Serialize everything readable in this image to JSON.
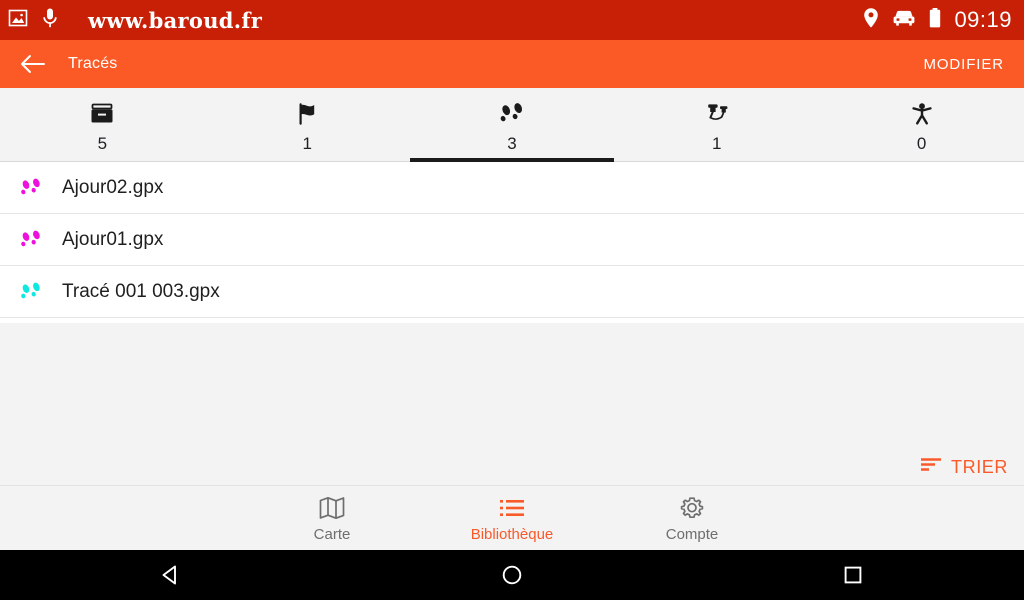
{
  "status_bar": {
    "site_title": "www.baroud.fr",
    "clock": "09:19",
    "left_icons": [
      "image-icon",
      "microphone-icon"
    ],
    "right_icons": [
      "location-pin-icon",
      "car-icon",
      "battery-icon"
    ],
    "background_color": "#c72007"
  },
  "app_bar": {
    "back_icon": "back-arrow-icon",
    "title": "Tracés",
    "action_label": "MODIFIER",
    "background_color": "#fb5a26"
  },
  "tabs": [
    {
      "icon": "archive-box-icon",
      "count": "5",
      "active": false
    },
    {
      "icon": "flag-icon",
      "count": "1",
      "active": false
    },
    {
      "icon": "footsteps-icon",
      "count": "3",
      "active": true
    },
    {
      "icon": "pushpins-icon",
      "count": "1",
      "active": false
    },
    {
      "icon": "person-icon",
      "count": "0",
      "active": false
    }
  ],
  "list": {
    "rows": [
      {
        "icon": "footsteps-icon",
        "icon_color": "#ee11dd",
        "label": "Ajour02.gpx"
      },
      {
        "icon": "footsteps-icon",
        "icon_color": "#ee11dd",
        "label": "Ajour01.gpx"
      },
      {
        "icon": "footsteps-icon",
        "icon_color": "#0ee8e0",
        "label": "Tracé 001 003.gpx"
      }
    ]
  },
  "sort_button": {
    "icon": "sort-icon",
    "label": "TRIER",
    "color": "#f95a29"
  },
  "bottom_nav": {
    "items": [
      {
        "icon": "map-icon",
        "label": "Carte",
        "active": false
      },
      {
        "icon": "list-icon",
        "label": "Bibliothèque",
        "active": true
      },
      {
        "icon": "gear-icon",
        "label": "Compte",
        "active": false
      }
    ],
    "active_color": "#f95a29",
    "inactive_color": "#6e6e6e"
  },
  "android_nav": {
    "back": "back-triangle-icon",
    "home": "home-circle-icon",
    "recents": "recents-square-icon"
  }
}
